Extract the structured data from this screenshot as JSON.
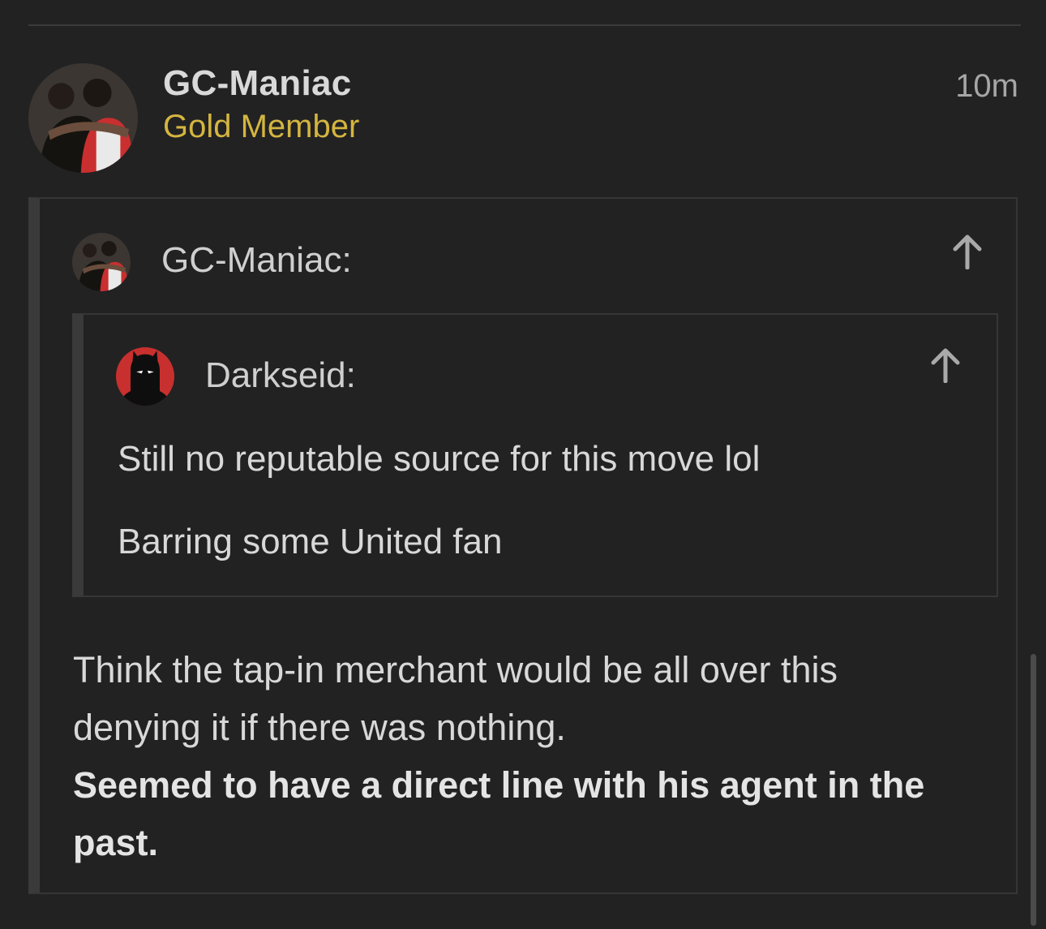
{
  "post": {
    "author": "GC-Maniac",
    "rank": "Gold Member",
    "time": "10m"
  },
  "quote": {
    "author_label": "GC-Maniac:",
    "nested": {
      "author_label": "Darkseid:",
      "lines": [
        "Still no reputable source for this move lol",
        "Barring some United fan"
      ]
    }
  },
  "reply": {
    "line1": "Think the tap-in merchant would be all over this",
    "line2": "denying it if there was nothing.",
    "bold_line1": "Seemed to have a direct line with his agent in the",
    "bold_line2": "past."
  },
  "icons": {
    "go_to_quote": "up-arrow-icon"
  },
  "colors": {
    "background": "#222223",
    "rank": "#d4b53f",
    "text": "#d8d8d8"
  }
}
